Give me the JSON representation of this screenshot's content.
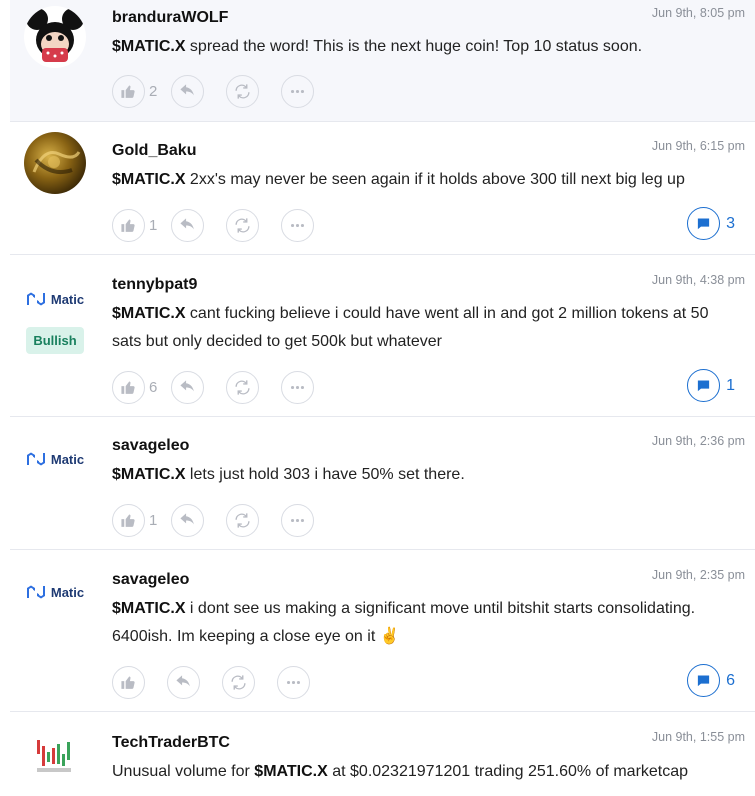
{
  "posts": [
    {
      "username": "branduraWOLF",
      "time": "Jun 9th, 8:05 pm",
      "avatar": "mickey-avatar",
      "ticker": "$MATIC.X",
      "text": " spread the word! This is the next huge coin! Top 10 status soon.",
      "likes": "2",
      "replies": ""
    },
    {
      "username": "Gold_Baku",
      "time": "Jun 9th, 6:15 pm",
      "avatar": "gold-avatar",
      "ticker": "$MATIC.X",
      "text": " 2xx's may never be seen again if it holds above 300 till next big leg up",
      "likes": "1",
      "replies": "3"
    },
    {
      "username": "tennybpat9",
      "time": "Jun 9th, 4:38 pm",
      "avatar": "matic-logo",
      "logo_text": "Matic",
      "badge": "Bullish",
      "ticker": "$MATIC.X",
      "text": " cant fucking believe i could have went all in and got 2 million tokens at 50 sats but only decided to get 500k but whatever",
      "likes": "6",
      "replies": "1"
    },
    {
      "username": "savageleo",
      "time": "Jun 9th, 2:36 pm",
      "avatar": "matic-logo",
      "logo_text": "Matic",
      "ticker": "$MATIC.X",
      "text": " lets just hold 303 i have 50% set there.",
      "likes": "1",
      "replies": ""
    },
    {
      "username": "savageleo",
      "time": "Jun 9th, 2:35 pm",
      "avatar": "matic-logo",
      "logo_text": "Matic",
      "ticker": "$MATIC.X",
      "text": " i dont see us making a significant move until bitshit starts consolidating. 6400ish. Im keeping a close eye on it ✌",
      "likes": "",
      "replies": "6"
    },
    {
      "username": "TechTraderBTC",
      "time": "Jun 9th, 1:55 pm",
      "avatar": "chart-avatar",
      "prefix": "Unusual volume for ",
      "ticker": "$MATIC.X",
      "text": " at $0.02321971201 trading 251.60% of marketcap",
      "likes": "",
      "replies": ""
    }
  ]
}
